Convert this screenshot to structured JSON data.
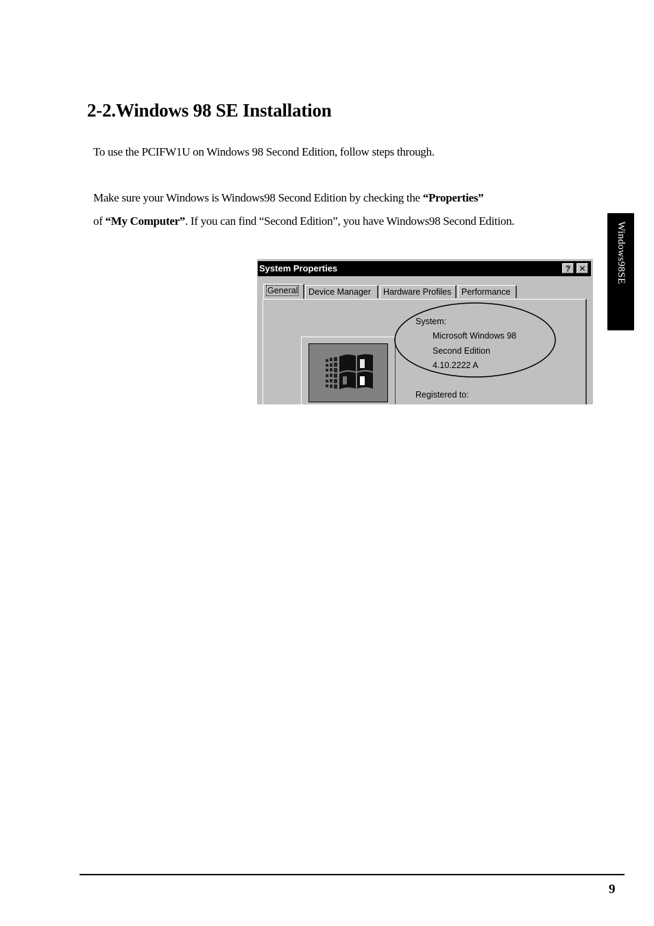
{
  "heading": "2-2.Windows 98 SE Installation",
  "intro": "To use the PCIFW1U on Windows 98 Second Edition, follow steps through.",
  "check": {
    "line1_pre": "Make sure your Windows is Windows98 Second Edition by checking the ",
    "line1_bold": "“Properties”",
    "line2_pre": "of ",
    "line2_bold": "“My Computer”",
    "line2_post": ". If you can find “Second Edition”, you have Windows98 Second Edition."
  },
  "side_tab": "Windows98SE",
  "dialog": {
    "title": "System Properties",
    "help_glyph": "?",
    "close_glyph": "✕",
    "tabs": [
      "General",
      "Device Manager",
      "Hardware Profiles",
      "Performance"
    ],
    "system_label": "System:",
    "os_name": "Microsoft Windows 98",
    "edition": "Second Edition",
    "version": "4.10.2222 A",
    "registered_label": "Registered to:"
  },
  "page_number": "9"
}
